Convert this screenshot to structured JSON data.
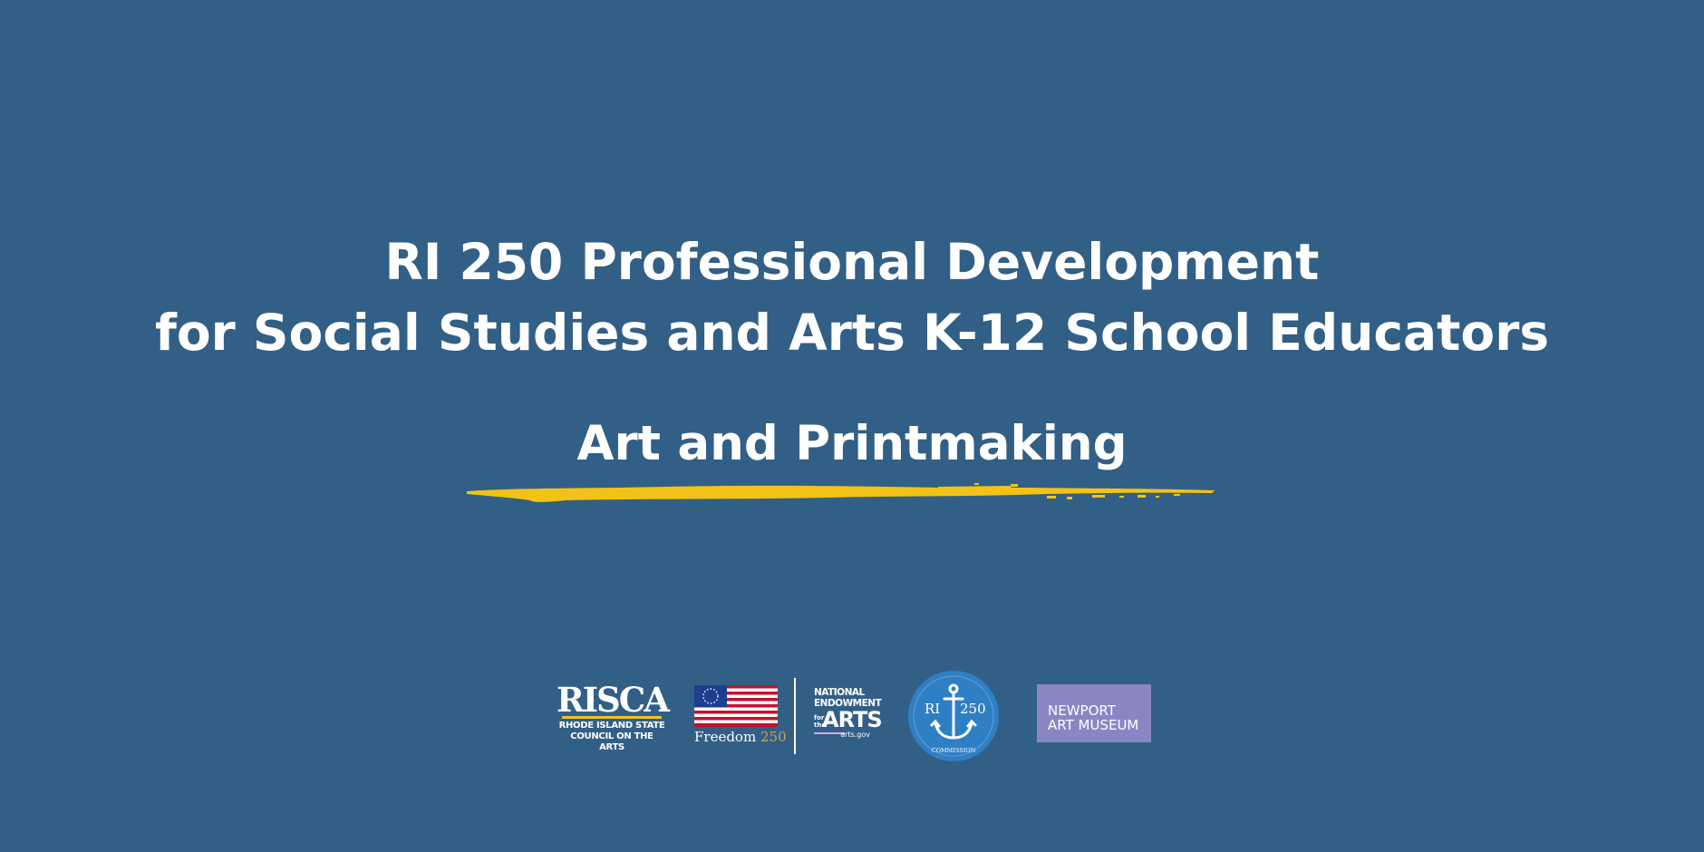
{
  "heading": {
    "line1": "RI 250 Professional Development",
    "line2": "for Social Studies and Arts K-12 School Educators",
    "subtitle": "Art and Printmaking"
  },
  "colors": {
    "background": "#325f86",
    "accent_brush": "#f2c316",
    "text": "#ffffff",
    "newport_box": "#8a86c4",
    "ri250_circle": "#2f7fc4"
  },
  "logos": {
    "risca": {
      "wordmark": "RISCA",
      "line1": "RHODE ISLAND STATE",
      "line2": "COUNCIL ON THE ARTS"
    },
    "freedom250": {
      "word": "Freedom",
      "number": "250"
    },
    "nea": {
      "line1": "NATIONAL",
      "line2": "ENDOWMENT",
      "for_the": "for the",
      "arts": "ARTS",
      "url": "arts.gov"
    },
    "ri250_commission": {
      "left": "RI",
      "right": "250",
      "bottom": "COMMISSION"
    },
    "newport": {
      "line1": "NEWPORT",
      "line2": "ART MUSEUM"
    }
  }
}
